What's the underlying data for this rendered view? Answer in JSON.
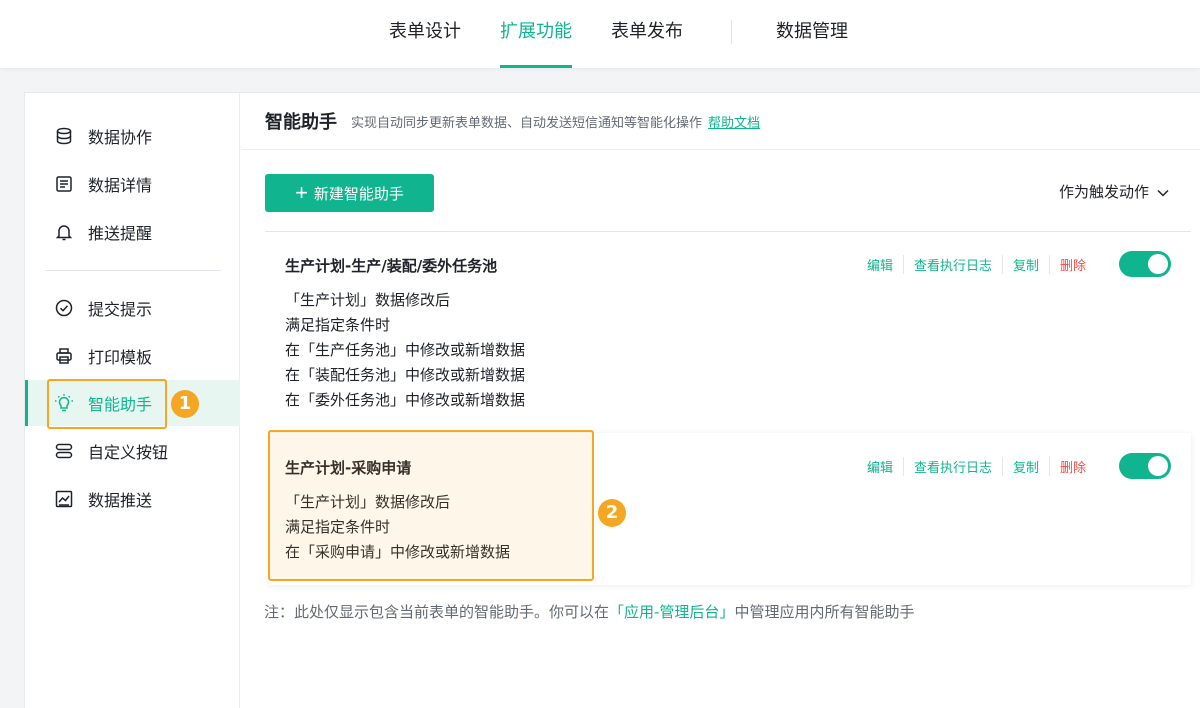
{
  "topnav": {
    "tabs": [
      {
        "label": "表单设计",
        "active": false
      },
      {
        "label": "扩展功能",
        "active": true
      },
      {
        "label": "表单发布",
        "active": false
      },
      {
        "label": "数据管理",
        "active": false
      }
    ]
  },
  "sidebar": {
    "items": [
      {
        "label": "数据协作",
        "icon": "database-icon"
      },
      {
        "label": "数据详情",
        "icon": "document-icon"
      },
      {
        "label": "推送提醒",
        "icon": "bell-icon"
      },
      {
        "label": "提交提示",
        "icon": "check-circle-icon"
      },
      {
        "label": "打印模板",
        "icon": "printer-icon"
      },
      {
        "label": "智能助手",
        "icon": "lightbulb-icon",
        "active": true
      },
      {
        "label": "自定义按钮",
        "icon": "buttons-icon"
      },
      {
        "label": "数据推送",
        "icon": "chart-icon"
      }
    ]
  },
  "annotations": {
    "badge1": "1",
    "badge2": "2",
    "color": "#f5a623"
  },
  "header": {
    "title": "智能助手",
    "description": "实现自动同步更新表单数据、自动发送短信通知等智能化操作",
    "help_link": "帮助文档"
  },
  "toolbar": {
    "new_button": "新建智能助手",
    "trigger_filter": "作为触发动作"
  },
  "actions": {
    "edit": "编辑",
    "log": "查看执行日志",
    "copy": "复制",
    "delete": "删除"
  },
  "assistants": [
    {
      "name": "生产计划-生产/装配/委外任务池",
      "enabled": true,
      "lines": [
        "「生产计划」数据修改后",
        "满足指定条件时",
        "在「生产任务池」中修改或新增数据",
        "在「装配任务池」中修改或新增数据",
        "在「委外任务池」中修改或新增数据"
      ]
    },
    {
      "name": "生产计划-采购申请",
      "enabled": true,
      "lines": [
        "「生产计划」数据修改后",
        "满足指定条件时",
        "在「采购申请」中修改或新增数据"
      ]
    }
  ],
  "note": {
    "prefix": "注：此处仅显示包含当前表单的智能助手。你可以在",
    "link": "「应用-管理后台」",
    "suffix": "中管理应用内所有智能助手"
  },
  "colors": {
    "accent": "#10b58f",
    "danger": "#f54a45",
    "highlight": "#f5a623"
  }
}
